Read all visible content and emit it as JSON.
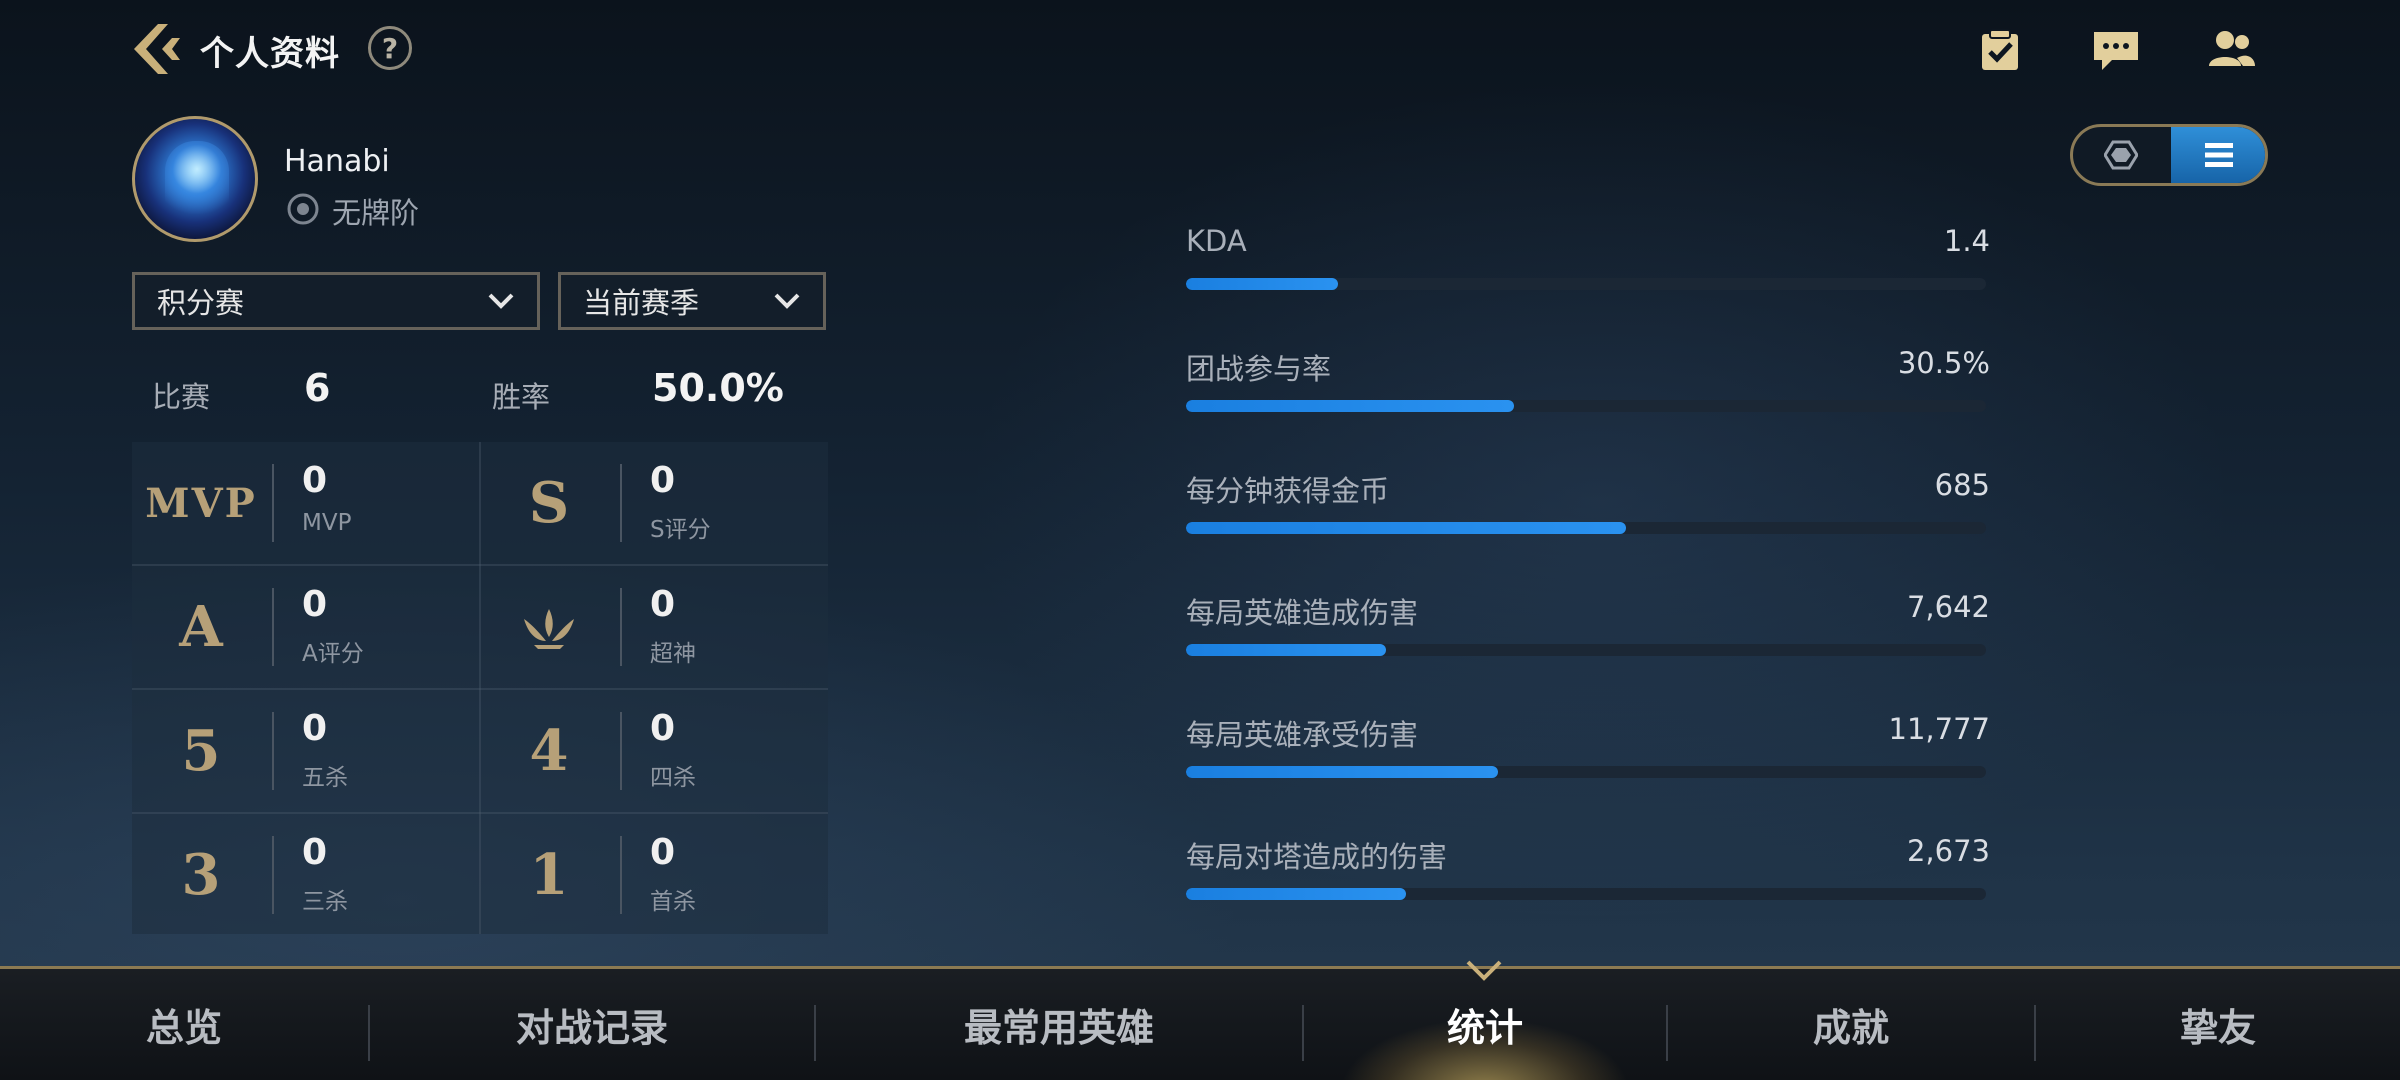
{
  "header": {
    "title": "个人资料",
    "help_label": "?",
    "icons": [
      "checklist-icon",
      "chat-icon",
      "friends-icon"
    ]
  },
  "profile": {
    "username": "Hanabi",
    "rank": "无牌阶"
  },
  "view_toggle": {
    "options": [
      "hexagon-icon",
      "list-icon"
    ],
    "selected": "list-icon"
  },
  "filters": {
    "mode": "积分赛",
    "season": "当前赛季"
  },
  "summary": {
    "matches_label": "比赛",
    "matches_value": "6",
    "winrate_label": "胜率",
    "winrate_value": "50.0%"
  },
  "stats": [
    {
      "emblem": "MVP",
      "value": "0",
      "label": "MVP"
    },
    {
      "emblem": "S",
      "value": "0",
      "label": "S评分"
    },
    {
      "emblem": "A",
      "value": "0",
      "label": "A评分"
    },
    {
      "emblem": "legendary-icon",
      "value": "0",
      "label": "超神"
    },
    {
      "emblem": "5",
      "value": "0",
      "label": "五杀"
    },
    {
      "emblem": "4",
      "value": "0",
      "label": "四杀"
    },
    {
      "emblem": "3",
      "value": "0",
      "label": "三杀"
    },
    {
      "emblem": "1",
      "value": "0",
      "label": "首杀"
    }
  ],
  "metrics": [
    {
      "name": "KDA",
      "value": "1.4",
      "fill": 0.19
    },
    {
      "name": "团战参与率",
      "value": "30.5%",
      "fill": 0.41
    },
    {
      "name": "每分钟获得金币",
      "value": "685",
      "fill": 0.55
    },
    {
      "name": "每局英雄造成伤害",
      "value": "7,642",
      "fill": 0.25
    },
    {
      "name": "每局英雄承受伤害",
      "value": "11,777",
      "fill": 0.39
    },
    {
      "name": "每局对塔造成的伤害",
      "value": "2,673",
      "fill": 0.275
    }
  ],
  "nav": {
    "items": [
      "总览",
      "对战记录",
      "最常用英雄",
      "统计",
      "成就",
      "挚友"
    ],
    "active": "统计"
  },
  "colors": {
    "accent_gold": "#b6a078",
    "bar_blue": "#1a7fe0",
    "toggle_active": "#2f8fd8"
  }
}
